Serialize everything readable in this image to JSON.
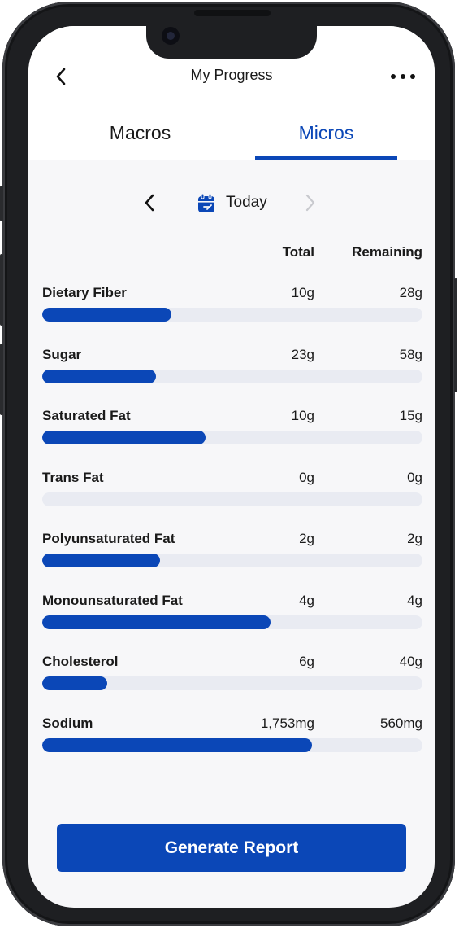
{
  "header": {
    "title": "My Progress",
    "back_icon": "chevron-left-icon",
    "more_icon": "more-horizontal-icon"
  },
  "tabs": [
    {
      "label": "Macros",
      "active": false
    },
    {
      "label": "Micros",
      "active": true
    }
  ],
  "date_nav": {
    "label": "Today",
    "prev_icon": "chevron-left-icon",
    "next_icon": "chevron-right-icon",
    "calendar_icon": "calendar-icon",
    "next_enabled": false
  },
  "columns": {
    "total": "Total",
    "remaining": "Remaining"
  },
  "nutrients": [
    {
      "name": "Dietary Fiber",
      "total": "10g",
      "remaining": "28g",
      "progress": 0.34
    },
    {
      "name": "Sugar",
      "total": "23g",
      "remaining": "58g",
      "progress": 0.3
    },
    {
      "name": "Saturated Fat",
      "total": "10g",
      "remaining": "15g",
      "progress": 0.43
    },
    {
      "name": "Trans Fat",
      "total": "0g",
      "remaining": "0g",
      "progress": 0.0
    },
    {
      "name": "Polyunsaturated Fat",
      "total": "2g",
      "remaining": "2g",
      "progress": 0.31
    },
    {
      "name": "Monounsaturated Fat",
      "total": "4g",
      "remaining": "4g",
      "progress": 0.6
    },
    {
      "name": "Cholesterol",
      "total": "6g",
      "remaining": "40g",
      "progress": 0.17
    },
    {
      "name": "Sodium",
      "total": "1,753mg",
      "remaining": "560mg",
      "progress": 0.71
    }
  ],
  "action": {
    "label": "Generate Report"
  },
  "colors": {
    "accent": "#0b47b7",
    "track": "#e9ebf2",
    "background": "#f7f7f9"
  }
}
